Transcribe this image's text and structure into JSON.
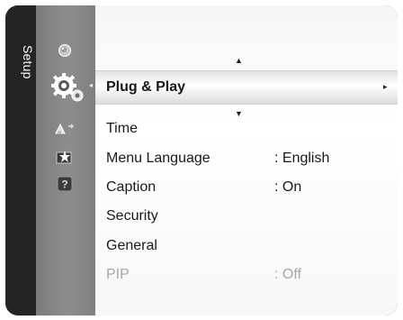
{
  "sidebar": {
    "title": "Setup",
    "icons": [
      "picture-icon",
      "setup-gear-icon",
      "input-icon",
      "application-icon",
      "support-help-icon"
    ],
    "active_icon": "setup-gear-icon"
  },
  "menu": {
    "highlighted": {
      "label": "Plug & Play",
      "submenu_arrow": "▸"
    },
    "items": [
      {
        "label": "Time",
        "value": ""
      },
      {
        "label": "Menu Language",
        "value": ": English"
      },
      {
        "label": "Caption",
        "value": ": On"
      },
      {
        "label": "Security",
        "value": ""
      },
      {
        "label": "General",
        "value": ""
      },
      {
        "label": "PIP",
        "value": ": Off",
        "disabled": true
      }
    ],
    "scroll_up": "▲",
    "scroll_down": "▼"
  },
  "colors": {
    "frame": "#242424",
    "icon_column": "#858585",
    "highlight": "#ffffff",
    "disabled_text": "#a7a7a7"
  }
}
